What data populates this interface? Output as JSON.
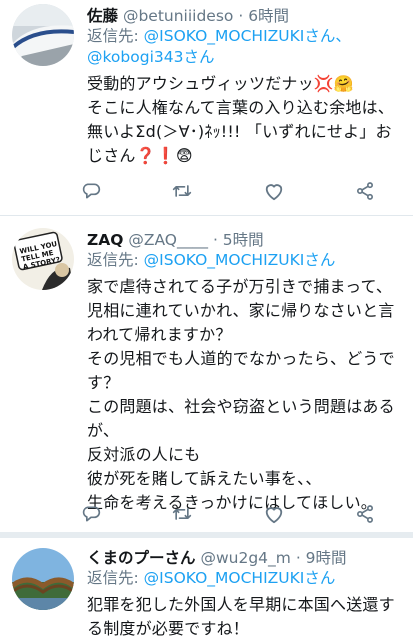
{
  "tweets": [
    {
      "name": "佐藤",
      "handle": "@betuniiideso",
      "time": "· 6時間",
      "reply_prefix": "返信先: ",
      "reply_mentions": "@ISOKO_MOCHIZUKIさん、",
      "reply_mentions2": "@kobogi343さん",
      "text": "受動的アウシュヴィッツだナッ💢🤗\nそこに人権なんて言葉の入り込む余地は、無いよΣd(＞∀･)ﾈｯ!!! 「いずれにせよ」おじさん❓❗😨"
    },
    {
      "name": "ZAQ",
      "handle": "@ZAQ____",
      "time": "· 5時間",
      "reply_prefix": "返信先: ",
      "reply_mentions": "@ISOKO_MOCHIZUKIさん",
      "text": "家で虐待されてる子が万引きで捕まって、児相に連れていかれ、家に帰りなさいと言われて帰れますか？\nその児相でも人道的でなかったら、どうです？\nこの問題は、社会や窃盗という問題はあるが、\n反対派の人にも\n彼が死を賭して訴えたい事を、、\n生命を考えるきっかけにはしてほしい。"
    },
    {
      "name": "くまのプーさん",
      "handle": "@wu2g4_m",
      "time": "· 9時間",
      "reply_prefix": "返信先: ",
      "reply_mentions": "@ISOKO_MOCHIZUKIさん",
      "text": "犯罪を犯した外国人を早期に本国へ送還する制度が必要ですね！"
    }
  ],
  "colors": {
    "link": "#1da1f2",
    "muted": "#657786",
    "icon": "#657786"
  },
  "icons": [
    "reply-icon",
    "retweet-icon",
    "like-icon",
    "share-icon"
  ]
}
